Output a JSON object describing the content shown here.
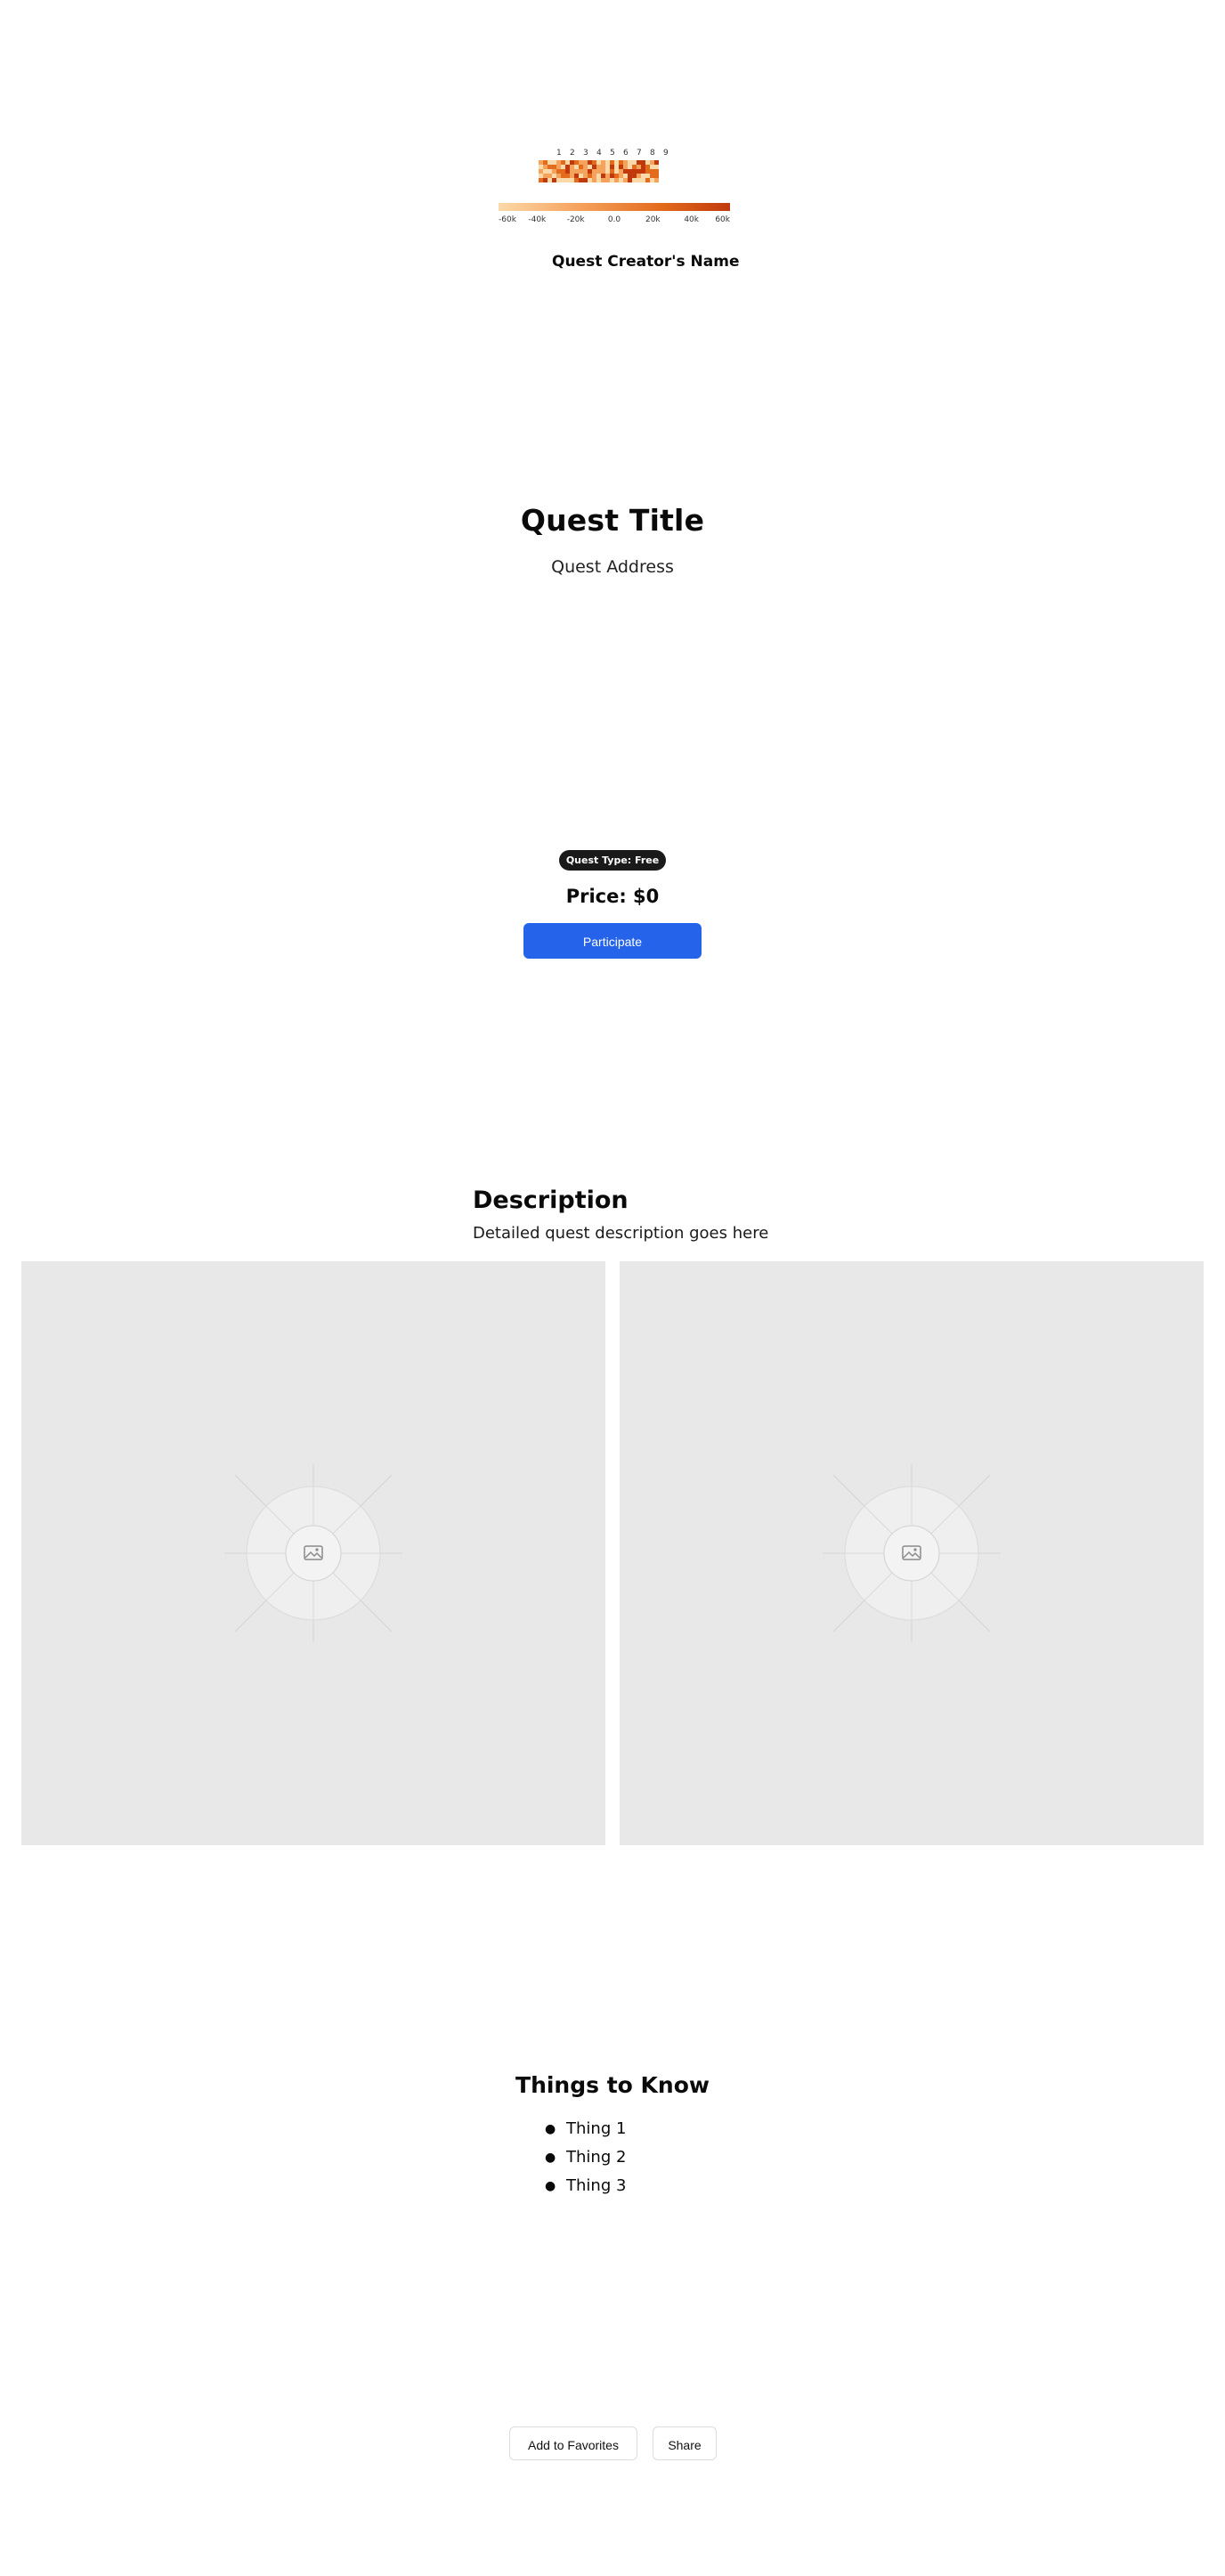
{
  "creator": {
    "name": "Quest Creator's Name",
    "avatar_icon": "heatmap-avatar-icon",
    "avatar_column_labels": [
      "1",
      "2",
      "3",
      "4",
      "5",
      "6",
      "7",
      "8",
      "9"
    ],
    "colorbar_labels": [
      "-60k",
      "-40k",
      "-20k",
      "0.0",
      "20k",
      "40k",
      "60k"
    ],
    "colorbar_colors": [
      "#fbd9a8",
      "#f5a25d",
      "#e36b1c",
      "#c0390c"
    ]
  },
  "quest": {
    "title": "Quest Title",
    "address": "Quest Address",
    "type_badge": "Quest Type: Free",
    "price": "Price: $0",
    "participate_label": "Participate"
  },
  "description": {
    "heading": "Description",
    "text": "Detailed quest description goes here",
    "images": [
      {
        "icon": "image-placeholder-icon"
      },
      {
        "icon": "image-placeholder-icon"
      }
    ]
  },
  "things_to_know": {
    "heading": "Things to Know",
    "items": [
      "Thing 1",
      "Thing 2",
      "Thing 3"
    ]
  },
  "actions": {
    "favorites_label": "Add to Favorites",
    "share_label": "Share"
  },
  "colors": {
    "primary": "#2563eb",
    "badge_bg": "#1a1a1a",
    "placeholder_bg": "#e8e8e8"
  }
}
